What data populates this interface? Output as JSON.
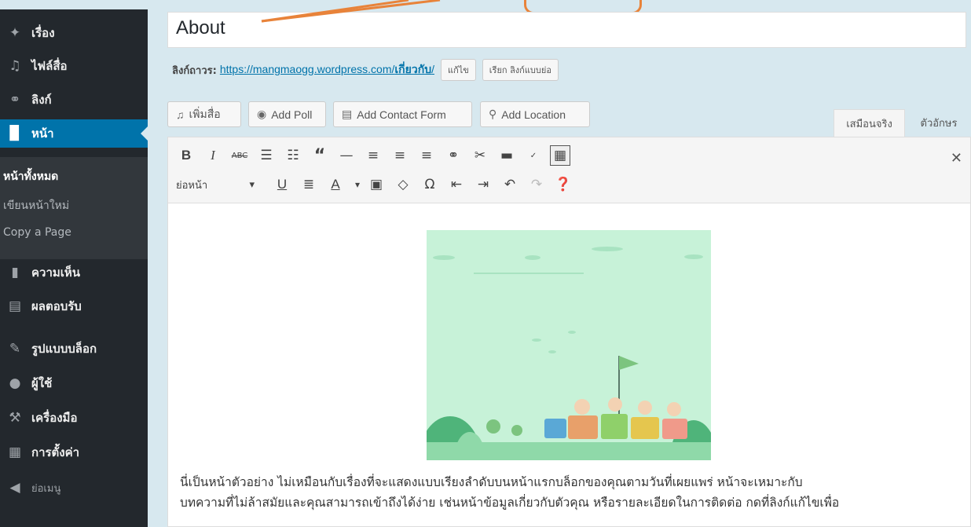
{
  "sidebar": {
    "items": [
      {
        "label": "เรื่อง",
        "icon": "pin-icon",
        "glyph": "📌"
      },
      {
        "label": "ไฟล์สื่อ",
        "icon": "media-icon",
        "glyph": "🎵"
      },
      {
        "label": "ลิงก์",
        "icon": "link-icon",
        "glyph": "🔗"
      },
      {
        "label": "หน้า",
        "icon": "page-icon",
        "glyph": "▉"
      },
      {
        "label": "ความเห็น",
        "icon": "comment-icon",
        "glyph": "▮"
      },
      {
        "label": "ผลตอบรับ",
        "icon": "feedback-icon",
        "glyph": "▤"
      },
      {
        "label": "รูปแบบบล็อก",
        "icon": "appearance-icon",
        "glyph": "✎"
      },
      {
        "label": "ผู้ใช้",
        "icon": "users-icon",
        "glyph": "👤"
      },
      {
        "label": "เครื่องมือ",
        "icon": "tools-icon",
        "glyph": "🔧"
      },
      {
        "label": "การตั้งค่า",
        "icon": "settings-icon",
        "glyph": "▦"
      },
      {
        "label": "ย่อเมนู",
        "icon": "collapse-icon",
        "glyph": "◀"
      }
    ],
    "submenu": [
      "หน้าทั้งหมด",
      "เขียนหน้าใหม่",
      "Copy a Page"
    ]
  },
  "editor": {
    "title": "About",
    "permalink_label": "ลิงก์ถาวร:",
    "permalink_base": "https://mangmaogg.wordpress.com/",
    "permalink_slug": "เกี่ยวกับ",
    "permalink_trail": "/",
    "edit_button": "แก้ไข",
    "shortlink_button": "เรียก ลิงก์แบบย่อ",
    "media_buttons": [
      "เพิ่มสื่อ",
      "Add Poll",
      "Add Contact Form",
      "Add Location"
    ],
    "tabs": [
      "เสมือนจริง",
      "ตัวอักษร"
    ],
    "format_select": "ย่อหน้า",
    "body_line1": "นี่เป็นหน้าตัวอย่าง ไม่เหมือนกับเรื่องที่จะแสดงแบบเรียงลำดับบนหน้าแรกบล็อกของคุณตามวันที่เผยแพร่ หน้าจะเหมาะกับ",
    "body_line2": "บทความที่ไม่ล้าสมัยและคุณสามารถเข้าถึงได้ง่าย เช่นหน้าข้อมูลเกี่ยวกับตัวคุณ หรือรายละเอียดในการติดต่อ กดที่ลิงก์แก้ไขเพื่อ"
  },
  "colors": {
    "sidebar_bg": "#23282d",
    "active_bg": "#0073aa",
    "annotation": "#e8833a",
    "illustration_bg": "#c7f2d8"
  }
}
